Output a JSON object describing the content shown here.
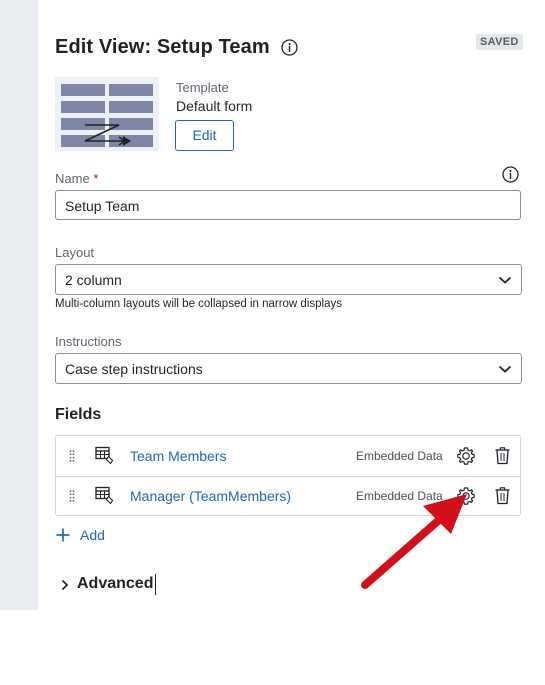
{
  "header": {
    "title": "Edit View: Setup Team",
    "status_badge": "SAVED"
  },
  "template": {
    "label": "Template",
    "value": "Default form",
    "edit_label": "Edit"
  },
  "name_field": {
    "label": "Name",
    "required_mark": "*",
    "value": "Setup Team"
  },
  "layout_field": {
    "label": "Layout",
    "value": "2 column",
    "hint": "Multi-column layouts will be collapsed in narrow displays"
  },
  "instructions_field": {
    "label": "Instructions",
    "value": "Case step instructions"
  },
  "fields": {
    "title": "Fields",
    "items": [
      {
        "name": "Team Members",
        "type": "Embedded Data"
      },
      {
        "name": "Manager (TeamMembers)",
        "type": "Embedded Data"
      }
    ],
    "add_label": "Add"
  },
  "advanced": {
    "label": "Advanced"
  },
  "colors": {
    "accent": "#1f66c2",
    "annotation_arrow": "#d3101a",
    "required": "#d0021b"
  },
  "icons": [
    "info-icon",
    "template-thumbnail",
    "chevron-down-icon",
    "drag-handle-icon",
    "table-icon",
    "gear-icon",
    "trash-icon",
    "plus-icon",
    "chevron-right-icon"
  ]
}
